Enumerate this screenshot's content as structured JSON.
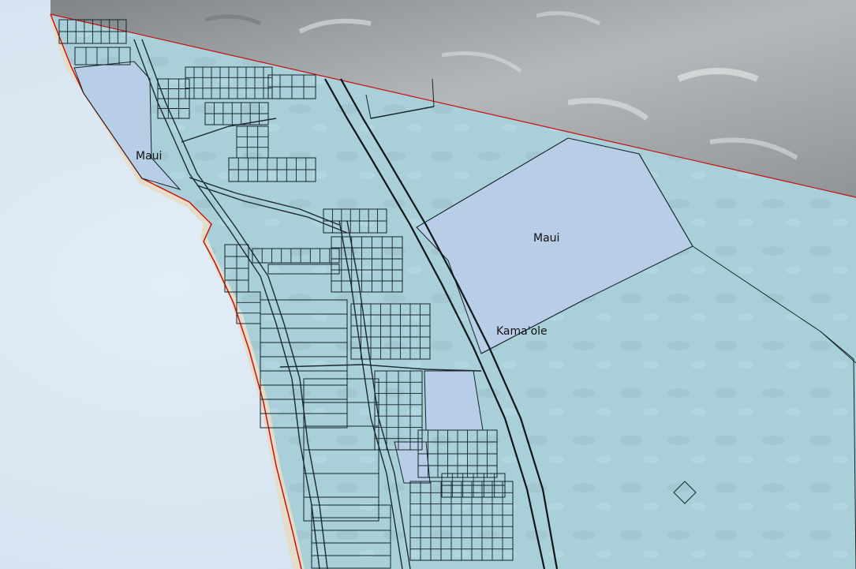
{
  "map": {
    "labels": {
      "maui_north": "Maui",
      "maui_east": "Maui",
      "kamaole": "Kama'ole"
    },
    "colors": {
      "ocean": "#d6e6f2",
      "land_parcels": "#a9cfd9",
      "highlighted_parcel": "#b8cde6",
      "hillshade": "#9c9c9c",
      "boundary": "#c81010",
      "parcel_lines": "#16242a"
    }
  }
}
